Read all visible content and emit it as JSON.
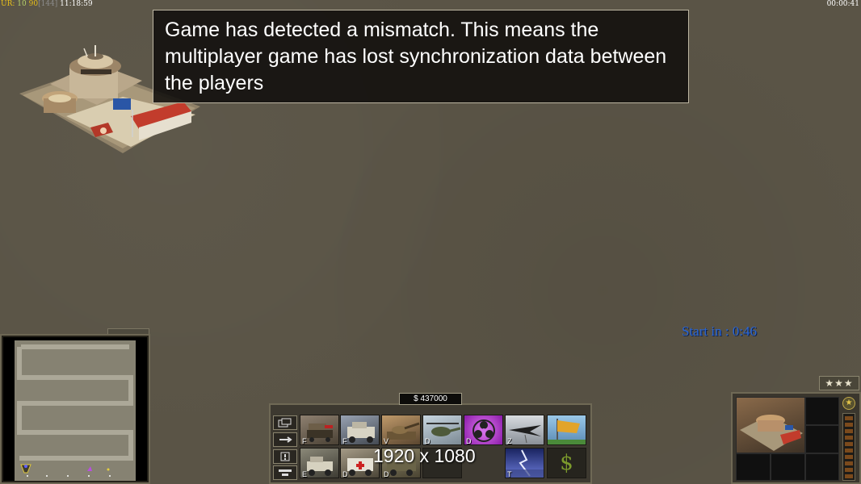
{
  "debug": {
    "label": "UR:",
    "v1": "10",
    "v2": "90",
    "v3": "[144]",
    "time": "11:18:59"
  },
  "game_clock": "00:00:41",
  "dialog": {
    "line1": "Game has detected a mismatch. This means the",
    "line2": " multiplayer game has lost synchronization data between",
    "line3": " the players"
  },
  "countdown": "Start in : 0:46",
  "money": "$ 437000",
  "resolution": "1920 x 1080",
  "rank_stars": "★★★",
  "command_buttons": [
    {
      "icon": "missile-launcher-unit-icon",
      "hotkey": "F"
    },
    {
      "icon": "humvee-unit-icon",
      "hotkey": "F"
    },
    {
      "icon": "tank-unit-icon",
      "hotkey": "V"
    },
    {
      "icon": "helicopter-unit-icon",
      "hotkey": "D"
    },
    {
      "icon": "biohazard-icon",
      "hotkey": "D"
    },
    {
      "icon": "stealth-bomber-icon",
      "hotkey": "Z"
    },
    {
      "icon": "flag-icon",
      "hotkey": ""
    },
    {
      "icon": "jeep-unit-icon",
      "hotkey": "E"
    },
    {
      "icon": "ambulance-unit-icon",
      "hotkey": "D"
    },
    {
      "icon": "truck-unit-icon",
      "hotkey": "D"
    },
    {
      "icon": "empty-slot",
      "hotkey": ""
    },
    {
      "icon": "lightning-storm-icon",
      "hotkey": "T"
    },
    {
      "icon": "dollar-icon",
      "hotkey": ""
    }
  ],
  "dollar_glyph": "$",
  "colors": {
    "terrain": "#5a5446",
    "countdown": "#2a66d6",
    "debug_yellow": "#e8c01a",
    "panel_border": "#6f6955"
  }
}
